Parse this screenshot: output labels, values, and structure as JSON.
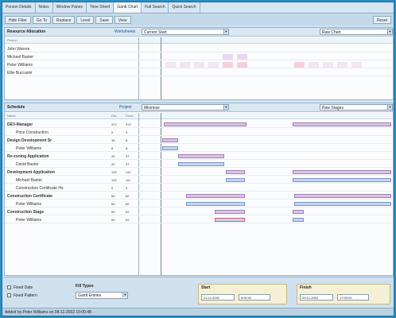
{
  "tabs": [
    "Person Details",
    "Notes",
    "Window Panes",
    "Time Sheet",
    "Gantt Chart",
    "Full Search",
    "Quick Search"
  ],
  "toolbar": {
    "buttons": [
      "Hide Filter",
      "Go To",
      "Replace",
      "Level",
      "Save",
      "View"
    ],
    "right_button": "Reset"
  },
  "resources": {
    "title": "Resource Allocation",
    "link": "Worksheets",
    "combo_left": "Current Start",
    "combo_right": "Raw Chart",
    "header": "Person",
    "rows": [
      "John Warren",
      "Michael Baxter",
      "Peter Williams",
      "Ellie Buccarini"
    ]
  },
  "schedule": {
    "title": "Schedule",
    "link": "Project",
    "combo_left": "Minimise",
    "combo_right": "Raw Stages",
    "col_name": "Name",
    "col_a": "Est.",
    "col_b": "Done",
    "rows": [
      {
        "name": "DEV-Manager",
        "a": "372",
        "b": "372",
        "bold": true
      },
      {
        "name": "Price Construction",
        "a": "0",
        "b": "0",
        "bold": false
      },
      {
        "name": "Design Development Sr",
        "a": "16",
        "b": "8",
        "bold": true
      },
      {
        "name": "Peter Williams",
        "a": "8",
        "b": "8",
        "bold": false
      },
      {
        "name": "Re-zoning Application",
        "a": "20",
        "b": "37",
        "bold": true
      },
      {
        "name": "David Baxter",
        "a": "20",
        "b": "37",
        "bold": false
      },
      {
        "name": "Development Application",
        "a": "132",
        "b": "141",
        "bold": true
      },
      {
        "name": "Michael Baxter",
        "a": "132",
        "b": "111",
        "bold": false
      },
      {
        "name": "Construction Certificate Hs",
        "a": "0",
        "b": "0",
        "bold": false
      },
      {
        "name": "Construction Certificate",
        "a": "60",
        "b": "60",
        "bold": true
      },
      {
        "name": "Peter Williams",
        "a": "60",
        "b": "60",
        "bold": false
      },
      {
        "name": "Construction Stage",
        "a": "50",
        "b": "52",
        "bold": true
      },
      {
        "name": "Peter Williams",
        "a": "50",
        "b": "52",
        "bold": false
      }
    ]
  },
  "bottom": {
    "fixed_date": "Fixed Date",
    "fixed_pattern": "Fixed Pattern",
    "fill_types": "Fill Types",
    "fill_value": "Gantt Entries",
    "start_label": "Start",
    "start_date": "21-11-2002",
    "start_time": "8:00:00",
    "finish_label": "Finish",
    "finish_date": "29-11-2002",
    "finish_time": "17:00:00"
  },
  "status": "Added by Peter Williams on 08-11-2002 10:00:48"
}
